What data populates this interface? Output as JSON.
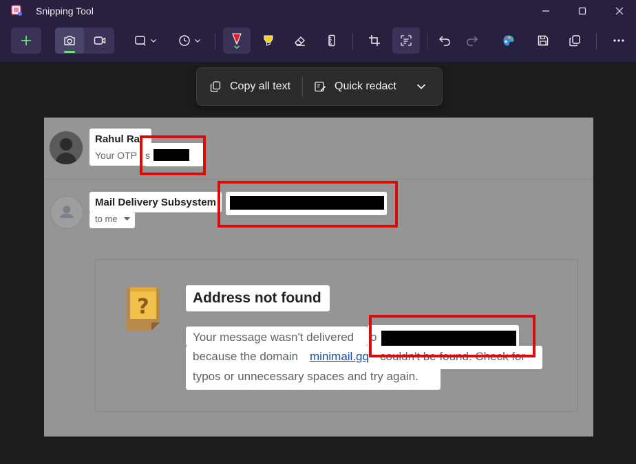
{
  "window": {
    "title": "Snipping Tool",
    "controls": [
      "minimize-icon",
      "maximize-icon",
      "close-icon"
    ]
  },
  "toolbar": {
    "buttons": [
      {
        "icon": "plus-icon",
        "label": "New"
      },
      {
        "icon": "camera-icon",
        "label": "Snip mode"
      },
      {
        "icon": "video-camera-icon",
        "label": "Record"
      },
      {
        "icon": "rectangle-snip-icon",
        "label": "Snip shape"
      },
      {
        "icon": "clock-icon",
        "label": "Delay"
      },
      {
        "icon": "red-pen-icon",
        "label": "Pen"
      },
      {
        "icon": "highlighter-icon",
        "label": "Highlighter"
      },
      {
        "icon": "eraser-icon",
        "label": "Eraser"
      },
      {
        "icon": "ruler-icon",
        "label": "Ruler"
      },
      {
        "icon": "crop-icon",
        "label": "Crop"
      },
      {
        "icon": "text-actions-icon",
        "label": "Text actions"
      },
      {
        "icon": "undo-icon",
        "label": "Undo"
      },
      {
        "icon": "redo-icon",
        "label": "Redo"
      },
      {
        "icon": "paint-icon",
        "label": "Edit in Paint"
      },
      {
        "icon": "save-icon",
        "label": "Save"
      },
      {
        "icon": "copy-icon",
        "label": "Copy"
      },
      {
        "icon": "more-icon",
        "label": "See more"
      }
    ],
    "accent": "#6ee07a",
    "pen_color": "#e11f2a",
    "highlighter_color": "#f7d21a"
  },
  "quick_actions": {
    "copy_all_text": "Copy all text",
    "quick_redact": "Quick redact"
  },
  "screenshot": {
    "message1": {
      "sender": "Rahul Rai",
      "sender_shown": "Rahul Ra",
      "snippet": "Your OTP is",
      "snippet_shown": "Your OTP",
      "snippet_tail": "s"
    },
    "message2": {
      "sender": "Mail Delivery Subsystem",
      "recipient": "to me"
    },
    "bounce": {
      "title": "Address not found",
      "line1": "Your message wasn't delivered to",
      "line1_shown": "Your message wasn't delivered",
      "line1_tail": "o",
      "line2_start": "because the domain",
      "domain_link": "minimail.gq",
      "line2_end": "couldn't be found. Check for",
      "line3": "typos or unnecessary spaces and try again.",
      "icon": "question-mark-document-icon"
    },
    "colors": {
      "highlight_box": "#d90b0b",
      "redaction": "#000000",
      "dimmed_background": "#959595"
    }
  }
}
